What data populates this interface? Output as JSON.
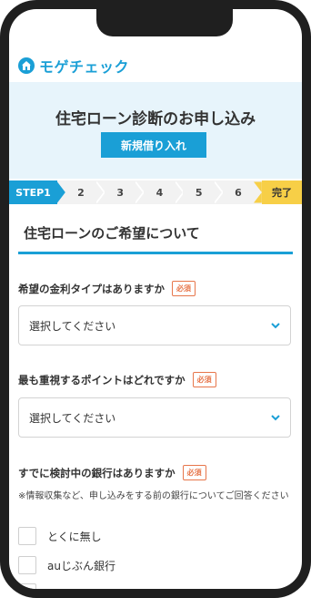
{
  "brand": {
    "name": "モゲチェック"
  },
  "hero": {
    "title": "住宅ローン診断のお申し込み",
    "button": "新規借り入れ"
  },
  "steps": [
    {
      "label": "STEP1",
      "state": "active"
    },
    {
      "label": "2",
      "state": "todo"
    },
    {
      "label": "3",
      "state": "todo"
    },
    {
      "label": "4",
      "state": "todo"
    },
    {
      "label": "5",
      "state": "todo"
    },
    {
      "label": "6",
      "state": "todo"
    },
    {
      "label": "完了",
      "state": "final"
    }
  ],
  "section": {
    "title": "住宅ローンのご希望について"
  },
  "questions": [
    {
      "label": "希望の金利タイプはありますか",
      "required": "必須",
      "select_value": "選択してください"
    },
    {
      "label": "最も重視するポイントはどれですか",
      "required": "必須",
      "select_value": "選択してください"
    },
    {
      "label": "すでに検討中の銀行はありますか",
      "required": "必須",
      "note": "※情報収集など、申し込みをする前の銀行についてご回答ください",
      "options": [
        "とくに無し",
        "auじぶん銀行"
      ]
    }
  ],
  "colors": {
    "accent": "#1a9fd6",
    "required": "#e7764b",
    "done": "#f7cf47",
    "hero_bg": "#e7f4fb"
  }
}
